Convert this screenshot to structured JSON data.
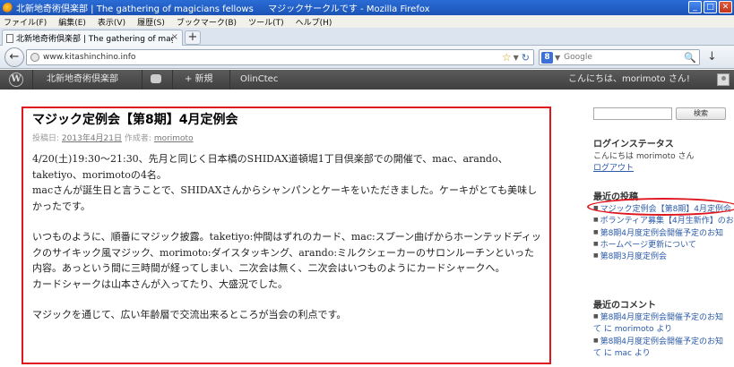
{
  "window": {
    "title": "北新地奇術倶楽部 | The gathering of magicians fellows 　 マジックサークルです - Mozilla Firefox",
    "min_glyph": "_",
    "max_glyph": "□",
    "close_glyph": "✕"
  },
  "menu": [
    "ファイル(F)",
    "編集(E)",
    "表示(V)",
    "履歴(S)",
    "ブックマーク(B)",
    "ツール(T)",
    "ヘルプ(H)"
  ],
  "tab": {
    "title": "北新地奇術倶楽部 | The gathering of mag...",
    "close_glyph": "×",
    "new_glyph": "+"
  },
  "nav": {
    "url": "www.kitashinchino.info",
    "search_engine": "Google",
    "search_placeholder": "Google"
  },
  "wpbar": {
    "site": "北新地奇術倶楽部",
    "new": "+ 新規",
    "extra": "OlinCtec",
    "greeting": "こんにちは、morimoto さん!"
  },
  "post": {
    "title": "マジック定例会【第8期】4月定例会",
    "meta_prefix": "投稿日:",
    "date": "2013年4月21日",
    "author_prefix": "作成者:",
    "author": "morimoto",
    "paragraphs": [
      "4/20(土)19:30〜21:30、先月と同じく日本橋のSHIDAX道頓堀1丁目倶楽部での開催で、mac、arando、taketiyo、morimotoの4名。",
      "macさんが誕生日と言うことで、SHIDAXさんからシャンパンとケーキをいただきました。ケーキがとても美味しかったです。",
      "",
      "いつものように、順番にマジック披露。taketiyo:仲間はずれのカード、mac:スプーン曲げからホーンテッドディックのサイキック風マジック、morimoto:ダイスタッキング、arando:ミルクシェーカーのサロンルーチンといった内容。あっという間に三時間が経ってしまい、二次会は無く、二次会はいつものようにカードシャークへ。",
      "カードシャークは山本さんが入ってたり、大盛況でした。",
      "",
      "マジックを通じて、広い年齢層で交流出来るところが当会の利点です。"
    ]
  },
  "sidebar": {
    "search_button": "検索",
    "login_heading": "ログインステータス",
    "login_text": "こんにちは morimoto さん",
    "logout": "ログアウト",
    "recent_posts_heading": "最近の投稿",
    "recent_posts": [
      "マジック定例会【第8期】4月定例会",
      "ボランティア募集【4月生新作】のお",
      "第8期4月度定例会開催予定のお知",
      "ホームページ更新について",
      "第8期3月度定例会"
    ],
    "recent_comments_heading": "最近のコメント",
    "recent_comments": [
      "第8期4月度定例会開催予定のお知",
      "て に morimoto より",
      "第8期4月度定例会開催予定のお知",
      "て に mac より"
    ]
  }
}
